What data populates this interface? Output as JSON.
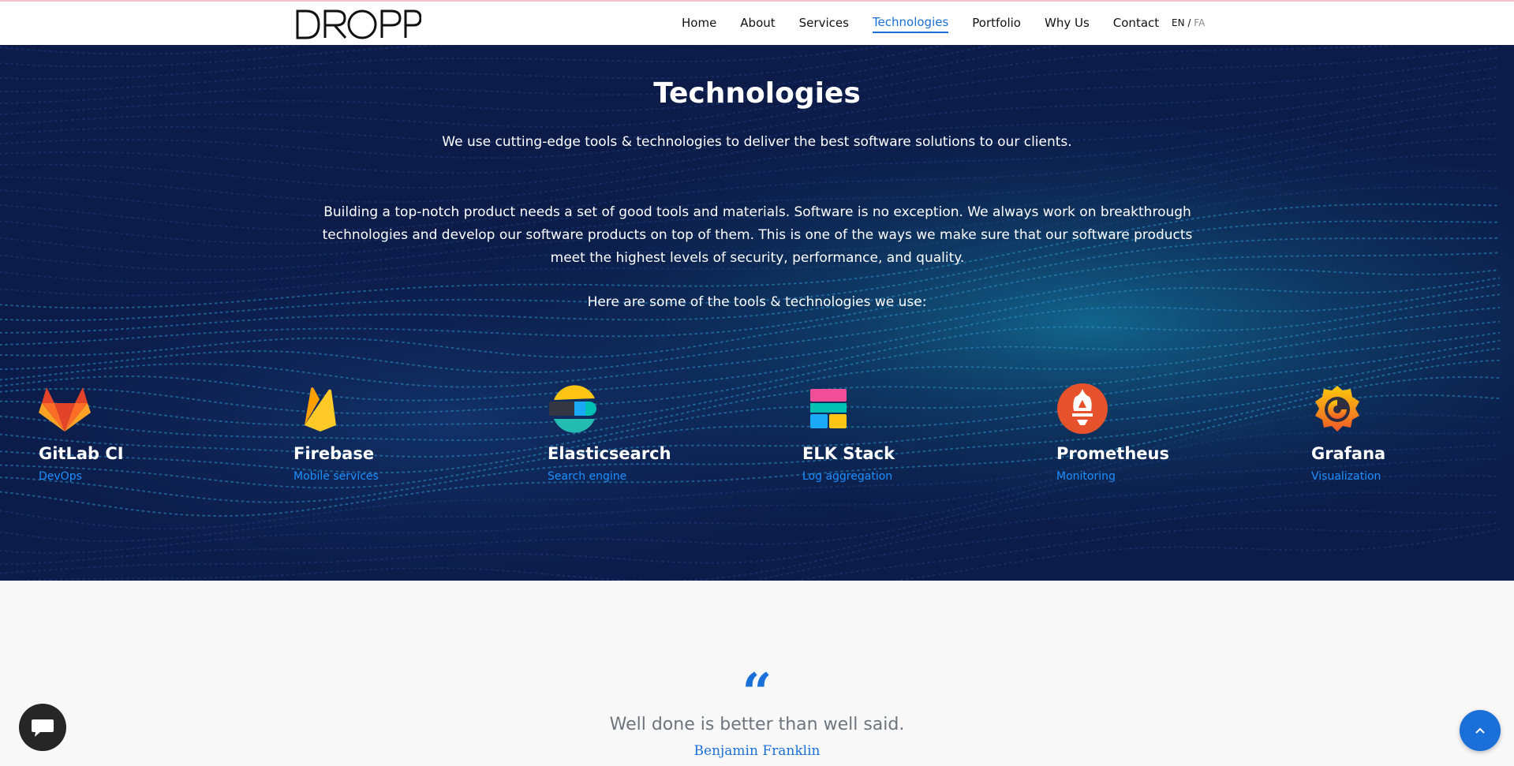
{
  "brand": {
    "logo_text": "DROPP"
  },
  "nav": {
    "items": [
      {
        "label": "Home"
      },
      {
        "label": "About"
      },
      {
        "label": "Services"
      },
      {
        "label": "Technologies",
        "active": true
      },
      {
        "label": "Portfolio"
      },
      {
        "label": "Why Us"
      },
      {
        "label": "Contact"
      }
    ],
    "lang": {
      "en": "EN",
      "sep": "/",
      "fa": "FA"
    }
  },
  "hero": {
    "title": "Technologies",
    "subtitle": "We use cutting-edge tools & technologies to deliver the best software solutions to our clients.",
    "body": "Building a top-notch product needs a set of good tools and materials. Software is no exception. We always work on breakthrough technologies and develop our software products on top of them. This is one of the ways we make sure that our software products meet the highest levels of security, performance, and quality.",
    "lead": "Here are some of the tools & technologies we use:"
  },
  "technologies": [
    {
      "name": "GitLab CI",
      "category": "DevOps",
      "icon": "gitlab-icon"
    },
    {
      "name": "Firebase",
      "category": "Mobile services",
      "icon": "firebase-icon"
    },
    {
      "name": "Elasticsearch",
      "category": "Search engine",
      "icon": "elasticsearch-icon"
    },
    {
      "name": "ELK Stack",
      "category": "Log aggregation",
      "icon": "elk-stack-icon"
    },
    {
      "name": "Prometheus",
      "category": "Monitoring",
      "icon": "prometheus-icon"
    },
    {
      "name": "Grafana",
      "category": "Visualization",
      "icon": "grafana-icon"
    }
  ],
  "quote": {
    "mark": "“",
    "text": "Well done is better than well said.",
    "author": "Benjamin Franklin"
  },
  "colors": {
    "accent": "#1a6fd8",
    "hero_bg": "#0c1b48",
    "category": "#1e90ff"
  }
}
